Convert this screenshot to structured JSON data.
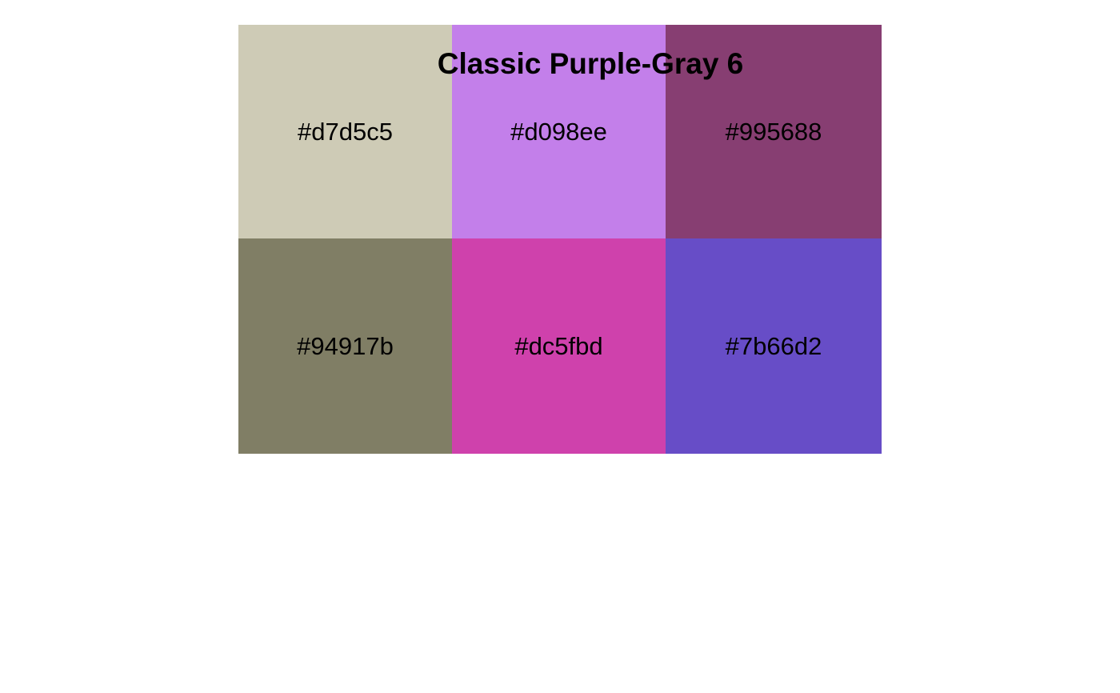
{
  "title": "Classic Purple-Gray 6",
  "swatches": [
    {
      "label": "#d7d5c5",
      "fill": "#cecbb6"
    },
    {
      "label": "#d098ee",
      "fill": "#c37fea"
    },
    {
      "label": "#995688",
      "fill": "#873e72"
    },
    {
      "label": "#94917b",
      "fill": "#807e65"
    },
    {
      "label": "#dc5fbd",
      "fill": "#cf41ac"
    },
    {
      "label": "#7b66d2",
      "fill": "#674dc7"
    }
  ]
}
